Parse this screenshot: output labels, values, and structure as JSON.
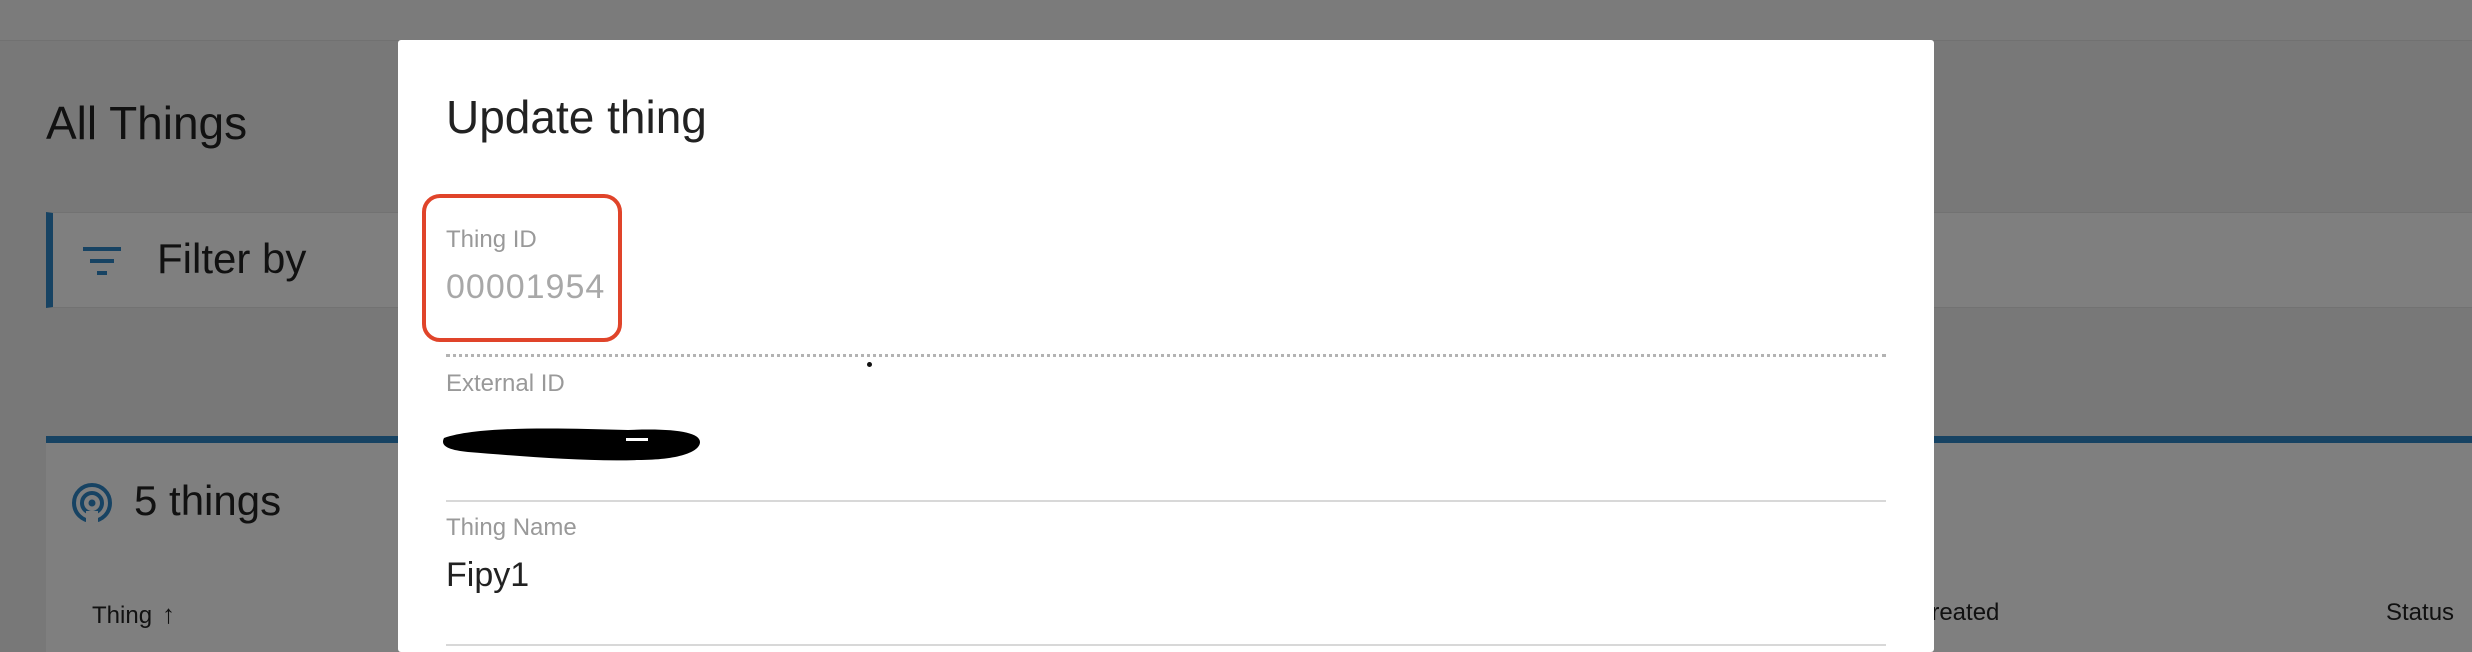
{
  "page": {
    "title": "All Things",
    "filter_label": "Filter by",
    "things_count_label": "5 things",
    "columns": {
      "thing": "Thing",
      "created": "Created",
      "status": "Status"
    }
  },
  "dialog": {
    "title": "Update thing",
    "fields": {
      "thing_id": {
        "label": "Thing ID",
        "value": "00001954"
      },
      "external_id": {
        "label": "External ID",
        "value": ""
      },
      "thing_name": {
        "label": "Thing Name",
        "value": "Fipy1"
      }
    }
  },
  "annotation": {
    "highlight_color": "#e0442a"
  },
  "colors": {
    "accent": "#2f86c6"
  },
  "icons": {
    "filter": "filter-icon",
    "things": "broadcast-icon",
    "sort": "arrow-up-icon"
  }
}
